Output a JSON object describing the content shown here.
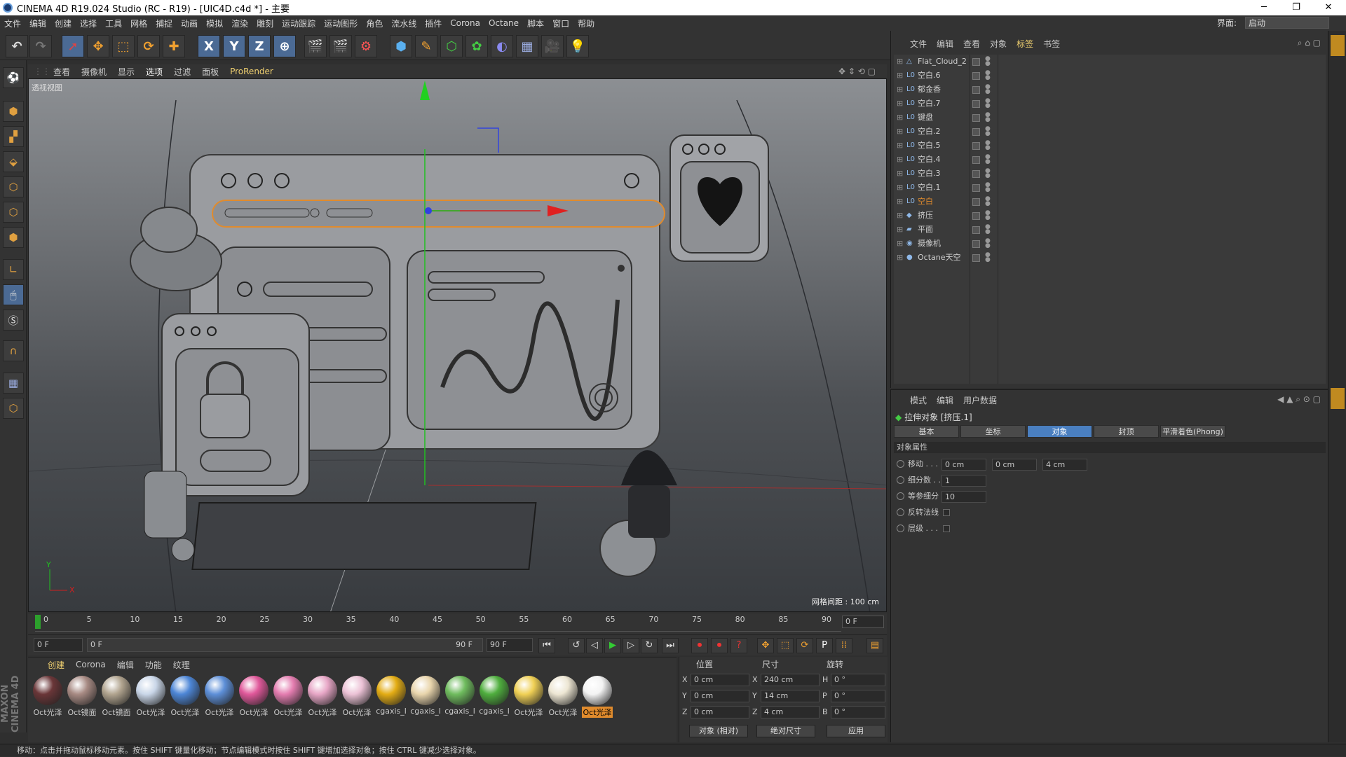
{
  "window": {
    "title": "CINEMA 4D R19.024 Studio (RC - R19) - [UIC4D.c4d *] - 主要"
  },
  "menu": [
    "文件",
    "编辑",
    "创建",
    "选择",
    "工具",
    "网格",
    "捕捉",
    "动画",
    "模拟",
    "渲染",
    "雕刻",
    "运动跟踪",
    "运动图形",
    "角色",
    "流水线",
    "插件",
    "Corona",
    "Octane",
    "脚本",
    "窗口",
    "帮助"
  ],
  "interface": {
    "label": "界面:",
    "value": "启动"
  },
  "toolbar_axis": [
    "X",
    "Y",
    "Z"
  ],
  "viewport": {
    "menu": [
      "查看",
      "摄像机",
      "显示",
      "选项",
      "过滤",
      "面板",
      "ProRender"
    ],
    "label": "透视视图",
    "grid_info": "网格间距 : 100 cm",
    "axis_y": "Y",
    "axis_x": "X"
  },
  "timeline": {
    "ticks": [
      "0",
      "5",
      "10",
      "15",
      "20",
      "25",
      "30",
      "35",
      "40",
      "45",
      "50",
      "55",
      "60",
      "65",
      "70",
      "75",
      "80",
      "85",
      "90"
    ],
    "current_frame": "0 F"
  },
  "transport": {
    "start": "0 F",
    "range_start": "0 F",
    "range_end": "90 F",
    "end": "90 F"
  },
  "materials": {
    "menu": [
      "创建",
      "Corona",
      "编辑",
      "功能",
      "纹理"
    ],
    "items": [
      {
        "label": "Oct光泽",
        "color": "#6a3638"
      },
      {
        "label": "Oct镜面",
        "color": "#a78a83"
      },
      {
        "label": "Oct镜面",
        "color": "#b1a48f"
      },
      {
        "label": "Oct光泽",
        "color": "#c9d6e8"
      },
      {
        "label": "Oct光泽",
        "color": "#4d86d6"
      },
      {
        "label": "Oct光泽",
        "color": "#5d8fd8"
      },
      {
        "label": "Oct光泽",
        "color": "#e0589a"
      },
      {
        "label": "Oct光泽",
        "color": "#e47db0"
      },
      {
        "label": "Oct光泽",
        "color": "#e7a6c6"
      },
      {
        "label": "Oct光泽",
        "color": "#ecc2d6"
      },
      {
        "label": "cgaxis_l",
        "color": "#e3ac14"
      },
      {
        "label": "cgaxis_l",
        "color": "#e9d5ac"
      },
      {
        "label": "cgaxis_l",
        "color": "#6fbc5e"
      },
      {
        "label": "cgaxis_l",
        "color": "#4fae3e"
      },
      {
        "label": "Oct光泽",
        "color": "#f0d055"
      },
      {
        "label": "Oct光泽",
        "color": "#ede6d3"
      },
      {
        "label": "Oct光泽",
        "color": "#f3f3f3"
      }
    ]
  },
  "coords": {
    "headers": [
      "位置",
      "尺寸",
      "旋转"
    ],
    "rows": [
      {
        "p": "X",
        "pv": "0 cm",
        "s": "X",
        "sv": "240 cm",
        "r": "H",
        "rv": "0 °"
      },
      {
        "p": "Y",
        "pv": "0 cm",
        "s": "Y",
        "sv": "14 cm",
        "r": "P",
        "rv": "0 °"
      },
      {
        "p": "Z",
        "pv": "0 cm",
        "s": "Z",
        "sv": "4 cm",
        "r": "B",
        "rv": "0 °"
      }
    ],
    "mode": "对象 (相对)",
    "size_mode": "绝对尺寸",
    "apply": "应用"
  },
  "objects": {
    "menu": [
      "文件",
      "编辑",
      "查看",
      "对象",
      "标签",
      "书签"
    ],
    "rows": [
      {
        "name": "Flat_Cloud_2",
        "icon": "△"
      },
      {
        "name": "空白.6",
        "icon": "L0"
      },
      {
        "name": "郁金香",
        "icon": "L0"
      },
      {
        "name": "空白.7",
        "icon": "L0"
      },
      {
        "name": "键盘",
        "icon": "L0"
      },
      {
        "name": "空白.2",
        "icon": "L0"
      },
      {
        "name": "空白.5",
        "icon": "L0"
      },
      {
        "name": "空白.4",
        "icon": "L0"
      },
      {
        "name": "空白.3",
        "icon": "L0"
      },
      {
        "name": "空白.1",
        "icon": "L0"
      },
      {
        "name": "空白",
        "icon": "L0"
      },
      {
        "name": "挤压",
        "icon": "◆"
      },
      {
        "name": "平面",
        "icon": "▰"
      },
      {
        "name": "摄像机",
        "icon": "◉"
      },
      {
        "name": "Octane天空",
        "icon": "●"
      }
    ]
  },
  "attributes": {
    "menu": [
      "模式",
      "编辑",
      "用户数据"
    ],
    "object": "拉伸对象 [挤压.1]",
    "tabs": [
      "基本",
      "坐标",
      "对象",
      "封顶",
      "平滑着色(Phong)"
    ],
    "section": "对象属性",
    "rows": [
      {
        "label": "移动 . . .",
        "v1": "0 cm",
        "v2": "0 cm",
        "v3": "4 cm"
      },
      {
        "label": "细分数 . .",
        "v1": "1"
      },
      {
        "label": "等参细分",
        "v1": "10"
      },
      {
        "label": "反转法线"
      },
      {
        "label": "层级 . . ."
      }
    ]
  },
  "status": "移动：点击并拖动鼠标移动元素。按住 SHIFT 键量化移动；节点编辑模式时按住 SHIFT 键增加选择对象；按住 CTRL 键减少选择对象。",
  "brand": "MAXON CINEMA 4D"
}
